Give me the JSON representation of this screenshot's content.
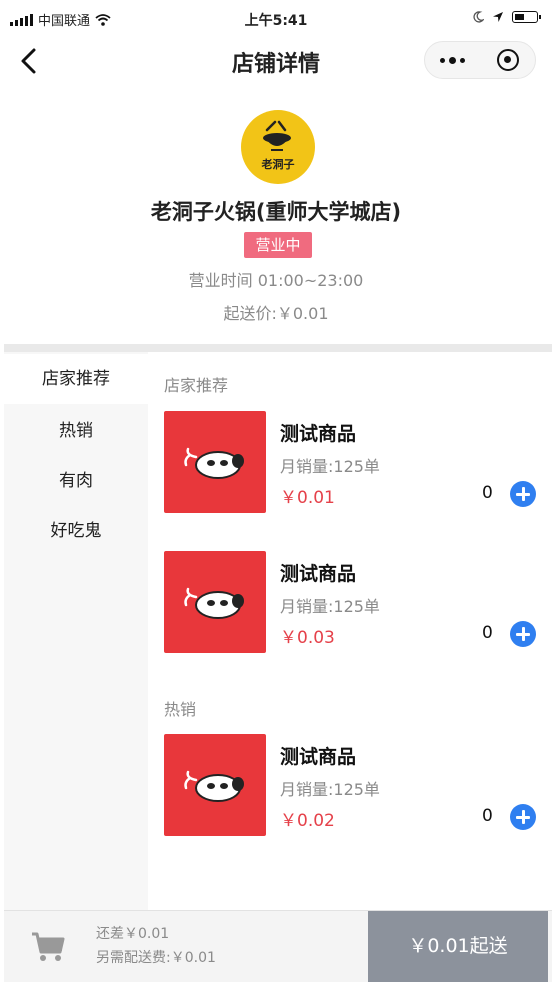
{
  "status_bar": {
    "carrier": "中国联通",
    "time": "上午5:41",
    "battery_level": 0.35
  },
  "nav": {
    "title": "店铺详情"
  },
  "shop": {
    "logo_text": "老洞子",
    "name": "老洞子火锅(重师大学城店)",
    "status": "营业中",
    "hours": "营业时间 01:00~23:00",
    "min_order": "起送价:￥0.01"
  },
  "sidebar": {
    "items": [
      {
        "label": "店家推荐",
        "active": true
      },
      {
        "label": "热销",
        "active": false
      },
      {
        "label": "有肉",
        "active": false
      },
      {
        "label": "好吃鬼",
        "active": false
      }
    ]
  },
  "sections": [
    {
      "title": "店家推荐",
      "products": [
        {
          "name": "测试商品",
          "sales": "月销量:125单",
          "price": "￥0.01",
          "qty": "0"
        },
        {
          "name": "测试商品",
          "sales": "月销量:125单",
          "price": "￥0.03",
          "qty": "0"
        }
      ]
    },
    {
      "title": "热销",
      "products": [
        {
          "name": "测试商品",
          "sales": "月销量:125单",
          "price": "￥0.02",
          "qty": "0"
        }
      ]
    }
  ],
  "cart": {
    "shortfall": "还差￥0.01",
    "delivery_fee": "另需配送费:￥0.01",
    "checkout_label": "￥0.01起送"
  },
  "colors": {
    "price_red": "#e5414a",
    "badge_pink": "#f06b7f",
    "add_blue": "#2f7ff0",
    "logo_yellow": "#f2c417",
    "product_red": "#e8373b",
    "checkout_gray": "#8c929c"
  },
  "icons": {
    "back": "chevron-left-icon",
    "more": "more-dots-icon",
    "close": "target-circle-icon",
    "add": "plus-circle-icon",
    "cart": "shopping-cart-icon"
  }
}
